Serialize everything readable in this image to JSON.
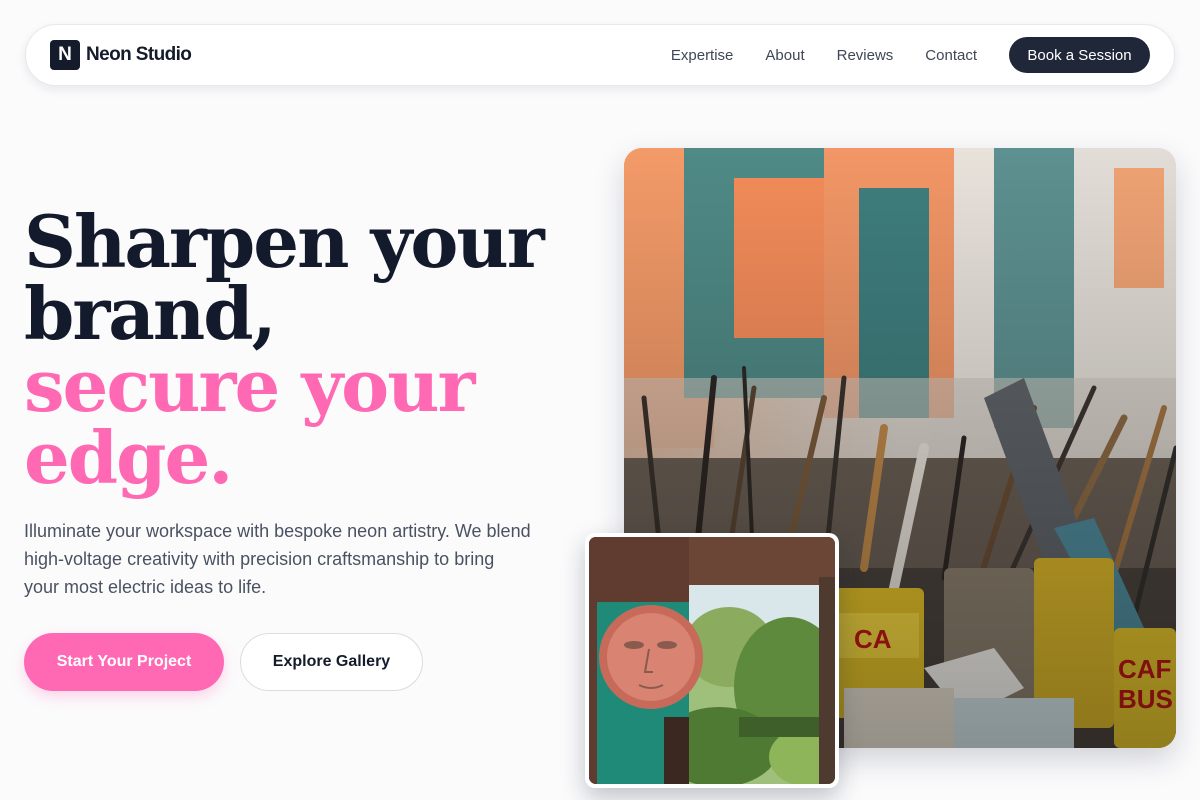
{
  "brand": {
    "mark": "N",
    "name": "Neon Studio"
  },
  "nav": {
    "links": [
      "Expertise",
      "About",
      "Reviews",
      "Contact"
    ],
    "cta": "Book a Session"
  },
  "hero": {
    "headline_dark_1": "Sharpen your",
    "headline_dark_2": "brand,",
    "headline_pink_1": "secure your",
    "headline_pink_2": "edge.",
    "subtext": "Illuminate your workspace with bespoke neon artistry. We blend high-voltage creativity with precision craftsmanship to bring your most electric ideas to life.",
    "primary_button": "Start Your Project",
    "secondary_button": "Explore Gallery"
  },
  "images": {
    "main": "paint-brushes-photo",
    "inset": "painted-face-mural-photo"
  },
  "colors": {
    "accent": "#ff69b4",
    "dark": "#131a2c",
    "nav_cta": "#1f2739"
  }
}
